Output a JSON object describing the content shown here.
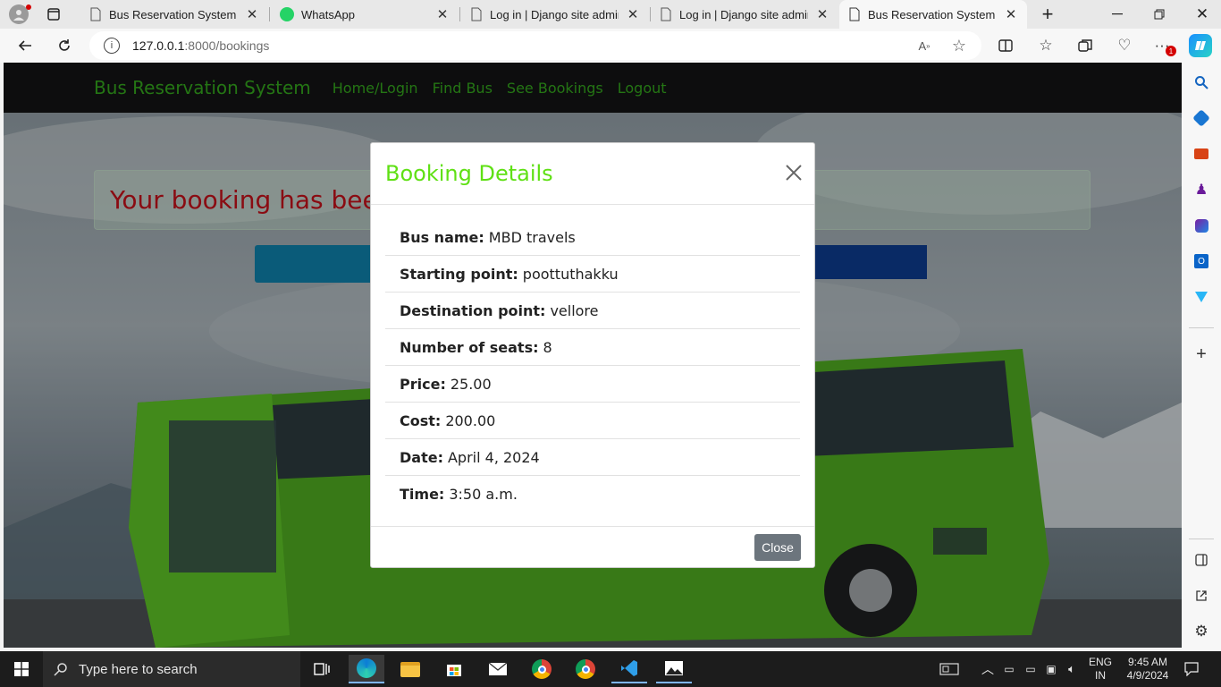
{
  "browser": {
    "tabs": [
      {
        "title": "Bus Reservation System in D"
      },
      {
        "title": "WhatsApp"
      },
      {
        "title": "Log in | Django site admin"
      },
      {
        "title": "Log in | Django site admin"
      },
      {
        "title": "Bus Reservation System in D"
      }
    ],
    "url_host": "127.0.0.1",
    "url_path": ":8000/bookings",
    "notification_badge": "1"
  },
  "site": {
    "brand": "Bus Reservation System",
    "nav": [
      "Home/Login",
      "Find Bus",
      "See Bookings",
      "Logout"
    ],
    "alert_text": "Your booking has been"
  },
  "modal": {
    "title": "Booking Details",
    "fields": [
      {
        "label": "Bus name:",
        "value": "MBD travels"
      },
      {
        "label": "Starting point:",
        "value": "poottuthakku"
      },
      {
        "label": "Destination point:",
        "value": "vellore"
      },
      {
        "label": "Number of seats:",
        "value": "8"
      },
      {
        "label": "Price:",
        "value": "25.00"
      },
      {
        "label": "Cost:",
        "value": "200.00"
      },
      {
        "label": "Date:",
        "value": "April 4, 2024"
      },
      {
        "label": "Time:",
        "value": "3:50 a.m."
      }
    ],
    "close_label": "Close"
  },
  "taskbar": {
    "search_placeholder": "Type here to search",
    "lang_line1": "ENG",
    "lang_line2": "IN",
    "time": "9:45 AM",
    "date": "4/9/2024"
  },
  "colors": {
    "nav_green": "#33a31c",
    "modal_title_green": "#5fe014",
    "alert_red": "#c0101a"
  }
}
